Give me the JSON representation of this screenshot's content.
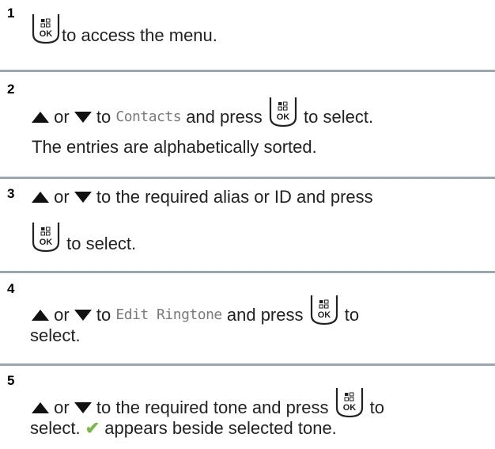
{
  "steps": [
    {
      "number": "1",
      "after_key": " to access the menu."
    },
    {
      "number": "2",
      "t1": " or ",
      "t2": " to ",
      "code": "Contacts",
      "t3": " and press ",
      "t4": " to select.",
      "line2": "The entries are alphabetically sorted."
    },
    {
      "number": "3",
      "t1": " or ",
      "t2": " to the required alias or ID and press",
      "after_key": " to select."
    },
    {
      "number": "4",
      "t1": " or ",
      "t2": " to ",
      "code": "Edit Ringtone",
      "t3": " and press ",
      "t4": " to",
      "line2": "select."
    },
    {
      "number": "5",
      "t1": " or ",
      "t2": " to the required tone and press ",
      "t4": " to",
      "line2a": "select. ",
      "check": "✔",
      "line2b": " appears beside selected tone."
    }
  ],
  "key": {
    "label": "OK",
    "icon": "menu-ok-key-icon"
  },
  "icons": {
    "up": "up-arrow-icon",
    "down": "down-arrow-icon",
    "check": "checkmark-icon"
  },
  "colors": {
    "separator": "#9aa6ad",
    "code": "#7a7a7a",
    "check": "#7bb84a"
  }
}
